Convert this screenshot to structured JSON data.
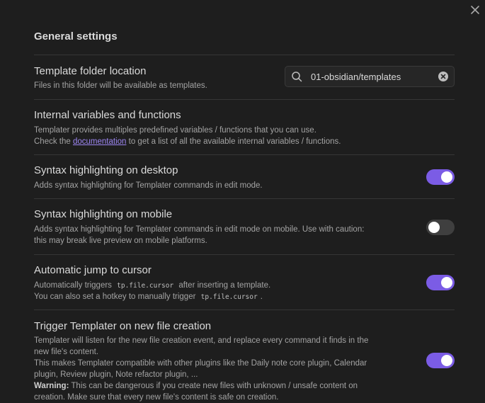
{
  "section": {
    "title": "General settings"
  },
  "settings": [
    {
      "name": "Template folder location",
      "desc_lines": [
        "Files in this folder will be available as templates."
      ],
      "control": "search",
      "value": "01-obsidian/templates"
    },
    {
      "name": "Internal variables and functions",
      "desc_line1": "Templater provides multiples predefined variables / functions that you can use.",
      "desc_line2_before": "Check the ",
      "desc_line2_link": "documentation",
      "desc_line2_after": " to get a list of all the available internal variables / functions."
    },
    {
      "name": "Syntax highlighting on desktop",
      "desc_lines": [
        "Adds syntax highlighting for Templater commands in edit mode."
      ],
      "enabled": true
    },
    {
      "name": "Syntax highlighting on mobile",
      "desc_lines": [
        "Adds syntax highlighting for Templater commands in edit mode on mobile. Use with caution:",
        "this may break live preview on mobile platforms."
      ],
      "enabled": false
    },
    {
      "name": "Automatic jump to cursor",
      "desc_line1_before": "Automatically triggers ",
      "desc_line1_code": "tp.file.cursor",
      "desc_line1_after": " after inserting a template.",
      "desc_line2_before": "You can also set a hotkey to manually trigger ",
      "desc_line2_code": "tp.file.cursor",
      "desc_line2_after": ".",
      "enabled": true
    },
    {
      "name": "Trigger Templater on new file creation",
      "desc_lines": [
        "Templater will listen for the new file creation event, and replace every command it finds in the",
        "new file's content.",
        "This makes Templater compatible with other plugins like the Daily note core plugin, Calendar",
        "plugin, Review plugin, Note refactor plugin, ..."
      ],
      "warning_label": "Warning:",
      "warning_text": " This can be dangerous if you create new files with unknown / unsafe content on",
      "warning_line2": "creation. Make sure that every new file's content is safe on creation.",
      "enabled": true
    }
  ],
  "colors": {
    "background": "#1e1e1e",
    "accent": "#7b5ce5",
    "link": "#9d86f2",
    "divider": "#363636"
  }
}
